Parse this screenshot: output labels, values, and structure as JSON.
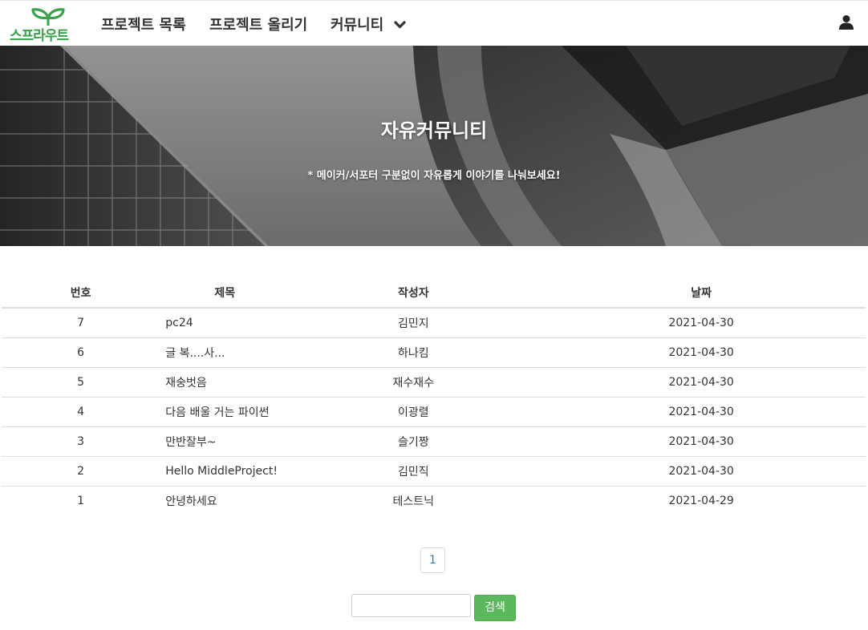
{
  "brand": {
    "logo_text": "스프라우트",
    "color": "#3aa04a"
  },
  "nav": {
    "items": [
      {
        "label": "프로젝트 목록"
      },
      {
        "label": "프로젝트 올리기"
      },
      {
        "label": "커뮤니티",
        "icon": "chevron-down-icon"
      }
    ],
    "user_icon": "user-icon"
  },
  "hero": {
    "title": "자유커뮤니티",
    "subtitle": "* 메이커/서포터 구분없이 자유롭게 이야기를 나눠보세요!"
  },
  "table": {
    "columns": [
      "번호",
      "제목",
      "작성자",
      "날짜"
    ],
    "rows": [
      {
        "no": "7",
        "title": "pc24",
        "writer": "김민지",
        "date": "2021-04-30"
      },
      {
        "no": "6",
        "title": "글 복....사...",
        "writer": "하나킴",
        "date": "2021-04-30"
      },
      {
        "no": "5",
        "title": "재숭벗음",
        "writer": "재수재수",
        "date": "2021-04-30"
      },
      {
        "no": "4",
        "title": "다음 배울 거는 파이썬",
        "writer": "이광렬",
        "date": "2021-04-30"
      },
      {
        "no": "3",
        "title": "만반잘부~",
        "writer": "슬기짱",
        "date": "2021-04-30"
      },
      {
        "no": "2",
        "title": "Hello MiddleProject!",
        "writer": "김민직",
        "date": "2021-04-30"
      },
      {
        "no": "1",
        "title": "안녕하세요",
        "writer": "테스트닉",
        "date": "2021-04-29"
      }
    ]
  },
  "pagination": {
    "current": "1"
  },
  "search": {
    "value": "",
    "button_label": "검색",
    "button_color": "#5cb85c"
  }
}
